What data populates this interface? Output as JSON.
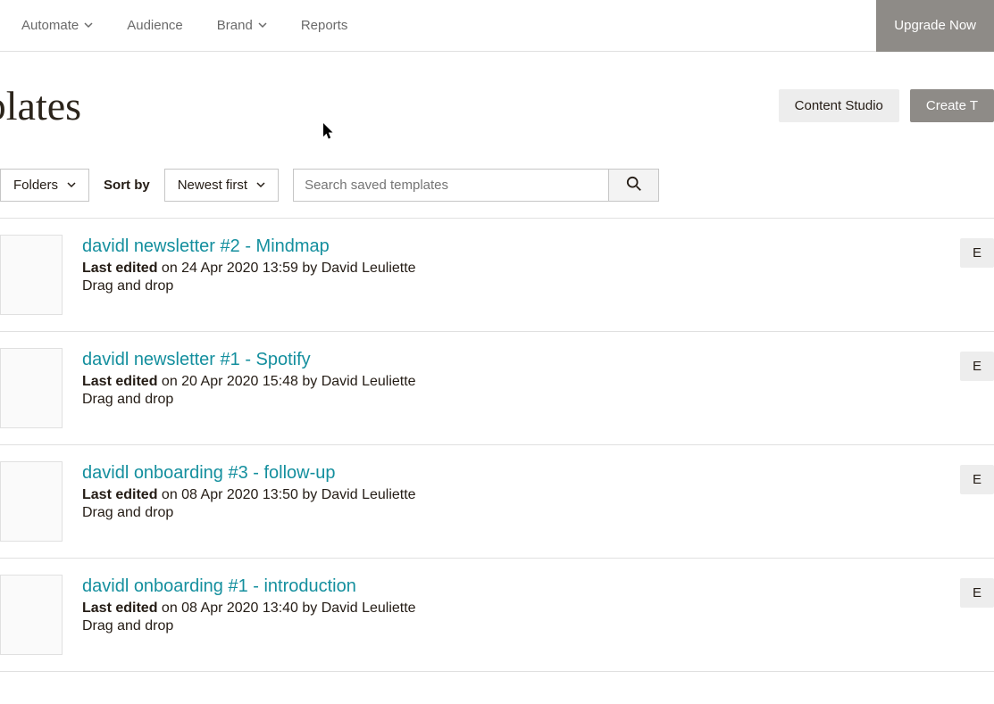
{
  "nav": {
    "items": [
      {
        "label": "Automate",
        "has_dropdown": true
      },
      {
        "label": "Audience",
        "has_dropdown": false
      },
      {
        "label": "Brand",
        "has_dropdown": true
      },
      {
        "label": "Reports",
        "has_dropdown": false
      }
    ],
    "upgrade": "Upgrade Now"
  },
  "page": {
    "title": "mplates",
    "content_studio": "Content Studio",
    "create": "Create T"
  },
  "toolbar": {
    "folders": "Folders",
    "sort_label": "Sort by",
    "sort_value": "Newest first",
    "search_placeholder": "Search saved templates"
  },
  "templates": [
    {
      "title": "davidl newsletter #2 - Mindmap",
      "edited_prefix": "Last edited",
      "edited_rest": " on 24 Apr 2020 13:59 by David Leuliette",
      "type": "Drag and drop",
      "action": "E"
    },
    {
      "title": "davidl newsletter #1 - Spotify",
      "edited_prefix": "Last edited",
      "edited_rest": " on 20 Apr 2020 15:48 by David Leuliette",
      "type": "Drag and drop",
      "action": "E"
    },
    {
      "title": "davidl onboarding #3 - follow-up",
      "edited_prefix": "Last edited",
      "edited_rest": " on 08 Apr 2020 13:50 by David Leuliette",
      "type": "Drag and drop",
      "action": "E"
    },
    {
      "title": "davidl onboarding #1 - introduction",
      "edited_prefix": "Last edited",
      "edited_rest": " on 08 Apr 2020 13:40 by David Leuliette",
      "type": "Drag and drop",
      "action": "E"
    }
  ]
}
